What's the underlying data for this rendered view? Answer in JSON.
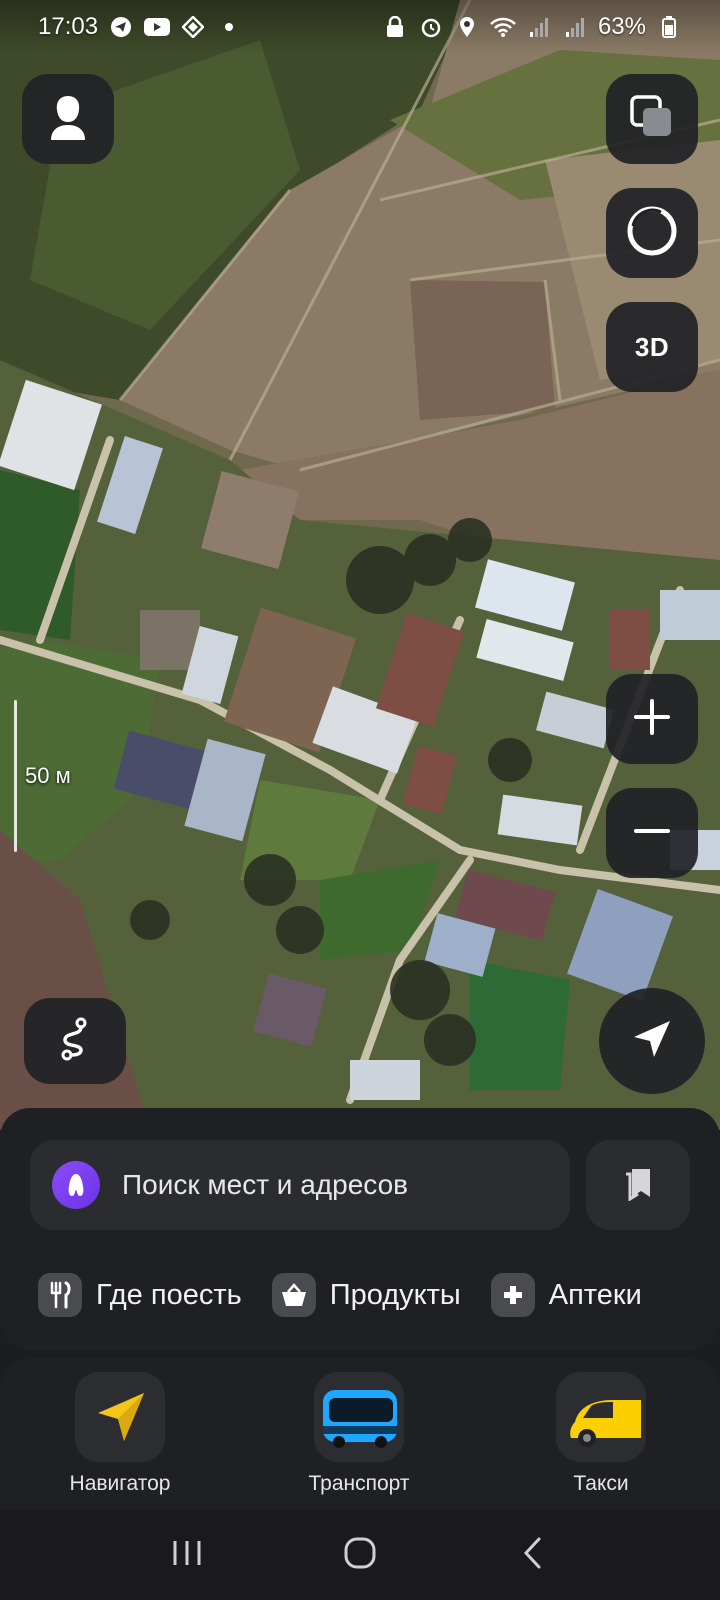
{
  "status_bar": {
    "time": "17:03",
    "battery": "63%",
    "left_icons": [
      "telegram-icon",
      "youtube-icon",
      "vpn-icon",
      "dot-icon"
    ],
    "right_icons": [
      "lock-icon",
      "alarm-icon",
      "location-icon",
      "wifi-icon",
      "signal-icon",
      "signal-icon",
      "battery-icon"
    ]
  },
  "map": {
    "type": "satellite",
    "scale_label": "50 м",
    "buttons": {
      "mode_3d": "3D"
    }
  },
  "search": {
    "placeholder": "Поиск мест и адресов"
  },
  "chips": [
    {
      "label": "Где поесть",
      "icon": "fork-knife-icon"
    },
    {
      "label": "Продукты",
      "icon": "basket-icon"
    },
    {
      "label": "Аптеки",
      "icon": "pharmacy-cross-icon"
    }
  ],
  "apps": [
    {
      "label": "Навигатор",
      "icon": "navigator-arrow-icon"
    },
    {
      "label": "Транспорт",
      "icon": "bus-icon"
    },
    {
      "label": "Такси",
      "icon": "taxi-car-icon"
    }
  ],
  "colors": {
    "alice_purple": "#7a3cf0",
    "navigator_yellow": "#f5c517",
    "taxi_yellow": "#fcd000",
    "bus_blue": "#1fa7ff"
  }
}
